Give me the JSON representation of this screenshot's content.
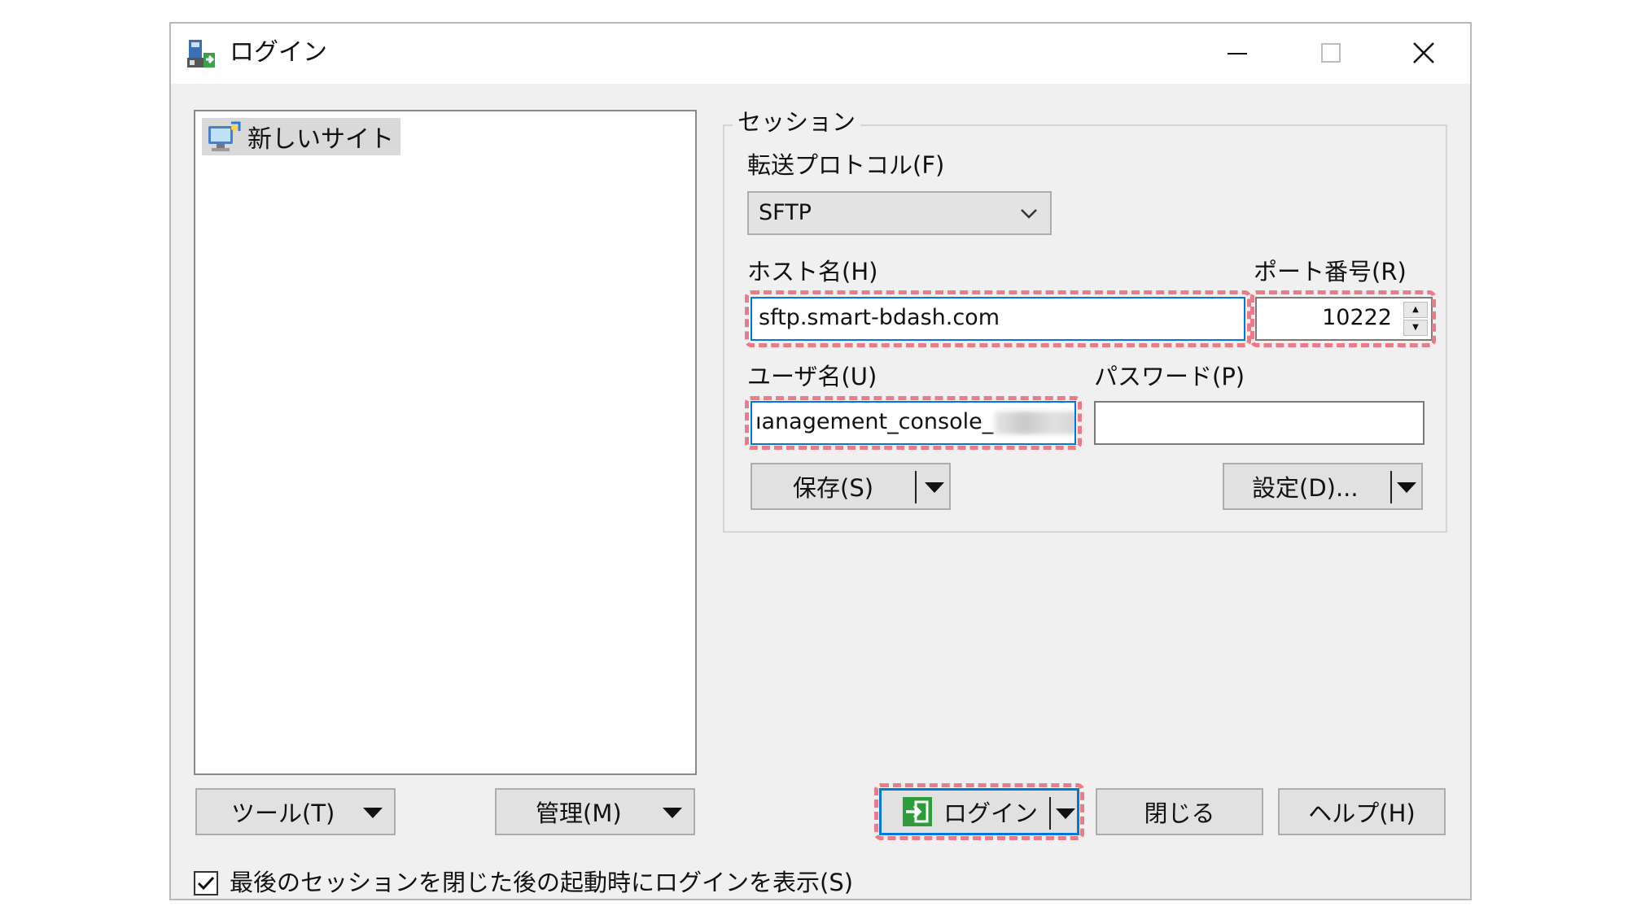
{
  "window": {
    "title": "ログイン",
    "controls": {
      "minimize": "minimize-icon",
      "maximize": "maximize-icon",
      "close": "close-icon"
    }
  },
  "site_tree": {
    "items": [
      {
        "label": "新しいサイト",
        "icon": "new-site-icon",
        "selected": true
      }
    ]
  },
  "session": {
    "group_label": "セッション",
    "protocol": {
      "label": "転送プロトコル(F)",
      "value": "SFTP"
    },
    "host": {
      "label": "ホスト名(H)",
      "value": "sftp.smart-bdash.com"
    },
    "port": {
      "label": "ポート番号(R)",
      "value": "10222"
    },
    "user": {
      "label": "ユーザ名(U)",
      "value": "ıanagement_console_"
    },
    "password": {
      "label": "パスワード(P)",
      "value": ""
    },
    "save_button": "保存(S)",
    "settings_button": "設定(D)..."
  },
  "footer": {
    "tools_button": "ツール(T)",
    "manage_button": "管理(M)",
    "login_button": "ログイン",
    "close_button": "閉じる",
    "help_button": "ヘルプ(H)",
    "startup_checkbox": {
      "label": "最後のセッションを閉じた後の起動時にログインを表示(S)",
      "checked": true
    }
  },
  "colors": {
    "highlight": "#ec7b88",
    "focus": "#0078d7",
    "login_icon": "#2e9c3a"
  }
}
